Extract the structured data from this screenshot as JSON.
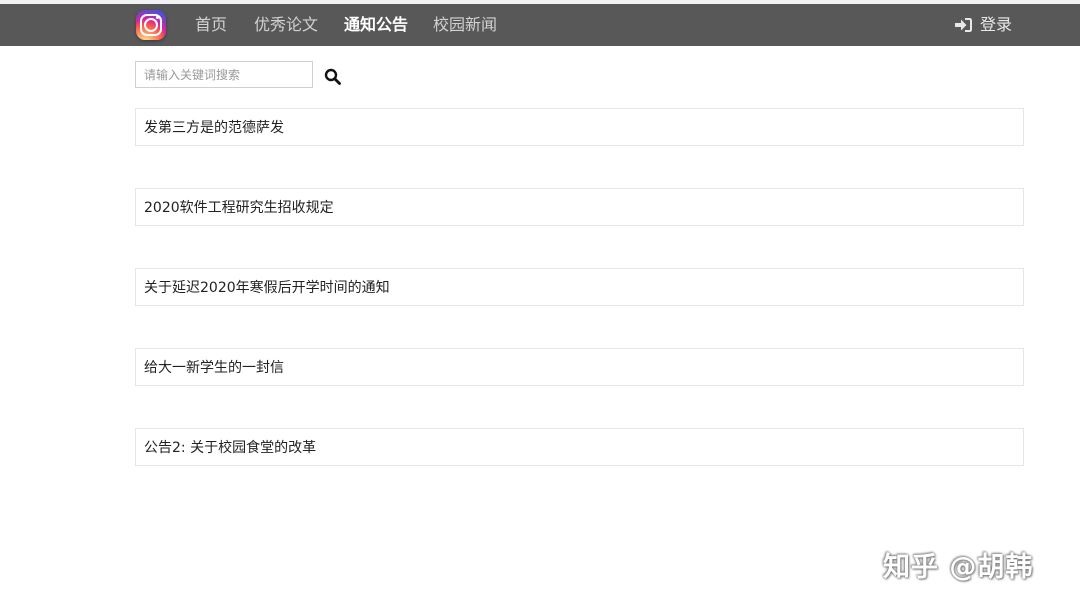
{
  "nav": {
    "items": [
      {
        "label": "首页"
      },
      {
        "label": "优秀论文"
      },
      {
        "label": "通知公告"
      },
      {
        "label": "校园新闻"
      }
    ],
    "login_label": "登录"
  },
  "search": {
    "placeholder": "请输入关键词搜索",
    "value": ""
  },
  "notices": [
    {
      "title": "发第三方是的范德萨发"
    },
    {
      "title": "2020软件工程研究生招收规定"
    },
    {
      "title": "关于延迟2020年寒假后开学时间的通知"
    },
    {
      "title": "给大一新学生的一封信"
    },
    {
      "title": "公告2:  关于校园食堂的改革"
    }
  ],
  "watermark": "知乎 @胡韩",
  "colors": {
    "navbar_bg": "#585858",
    "nav_text": "#d2d2d2",
    "nav_active": "#ffffff",
    "border": "#e6e6e6"
  },
  "icons": [
    "instagram-logo-icon",
    "sign-in-icon",
    "search-icon"
  ]
}
